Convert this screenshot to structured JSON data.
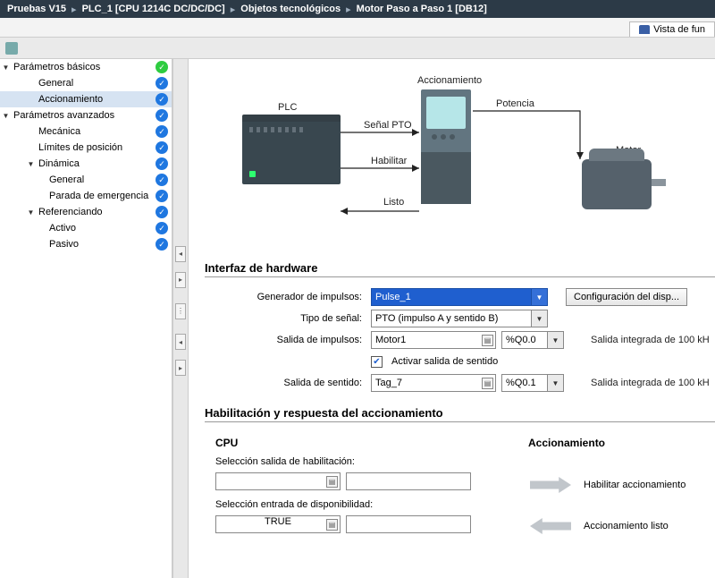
{
  "breadcrumb": [
    "Pruebas V15",
    "PLC_1 [CPU 1214C DC/DC/DC]",
    "Objetos tecnológicos",
    "Motor Paso a Paso 1 [DB12]"
  ],
  "tab": {
    "label": "Vista de fun"
  },
  "tree": {
    "items": [
      {
        "label": "Parámetros básicos",
        "level": 1,
        "toggle": "▼",
        "status": "ok"
      },
      {
        "label": "General",
        "level": 2,
        "status": "done"
      },
      {
        "label": "Accionamiento",
        "level": 2,
        "status": "done",
        "selected": true
      },
      {
        "label": "Parámetros avanzados",
        "level": 1,
        "toggle": "▼",
        "status": "done"
      },
      {
        "label": "Mecánica",
        "level": 2,
        "status": "done"
      },
      {
        "label": "Límites de posición",
        "level": 2,
        "status": "done"
      },
      {
        "label": "Dinámica",
        "level": 2,
        "toggle": "▼",
        "status": "done"
      },
      {
        "label": "General",
        "level": 3,
        "status": "done"
      },
      {
        "label": "Parada de emergencia",
        "level": 3,
        "status": "done"
      },
      {
        "label": "Referenciando",
        "level": 2,
        "toggle": "▼",
        "status": "done"
      },
      {
        "label": "Activo",
        "level": 3,
        "status": "done"
      },
      {
        "label": "Pasivo",
        "level": 3,
        "status": "done"
      }
    ]
  },
  "diagram": {
    "plc": "PLC",
    "drive": "Accionamiento",
    "motor": "Motor",
    "signals": {
      "pto": "Señal PTO",
      "enable": "Habilitar",
      "ready": "Listo",
      "power": "Potencia"
    }
  },
  "hw": {
    "title": "Interfaz de hardware",
    "pulseGenLabel": "Generador de impulsos:",
    "pulseGenValue": "Pulse_1",
    "configBtn": "Configuración del disp...",
    "signalTypeLabel": "Tipo de señal:",
    "signalTypeValue": "PTO (impulso A y sentido B)",
    "pulseOutLabel": "Salida de impulsos:",
    "pulseOutTag": "Motor1",
    "pulseOutAddr": "%Q0.0",
    "pulseOutNote": "Salida integrada de 100 kH",
    "dirCheckLabel": "Activar salida de sentido",
    "dirOutLabel": "Salida de sentido:",
    "dirOutTag": "Tag_7",
    "dirOutAddr": "%Q0.1",
    "dirOutNote": "Salida integrada de 100 kH"
  },
  "enable": {
    "title": "Habilitación y respuesta del accionamiento",
    "cpuHeader": "CPU",
    "drvHeader": "Accionamiento",
    "enableOutLabel": "Selección salida de habilitación:",
    "readyInLabel": "Selección entrada de disponibilidad:",
    "readyInValue": "TRUE",
    "enableDrv": "Habilitar accionamiento",
    "readyDrv": "Accionamiento listo"
  }
}
